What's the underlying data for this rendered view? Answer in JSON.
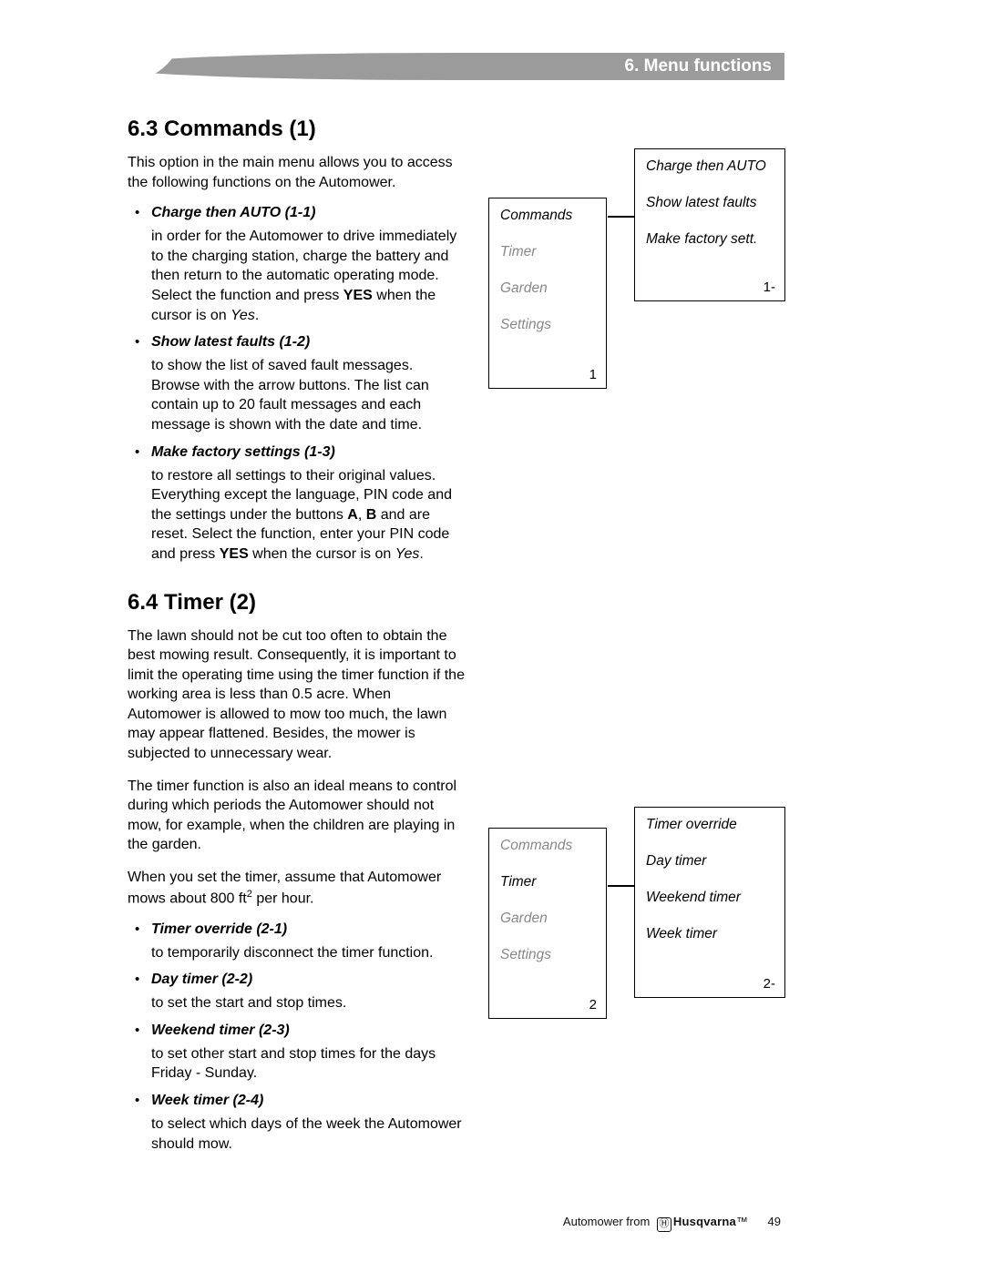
{
  "header": {
    "chapter": "6. Menu functions"
  },
  "section63": {
    "heading": "6.3 Commands (1)",
    "intro": "This option in the main menu allows you to access the following functions on the Automower.",
    "items": [
      {
        "title": "Charge then AUTO (1-1)",
        "desc_html": "in order for the Automower to drive immediately to the charging station, charge the battery and then return to the automatic operating mode. Select the function and press <b>YES</b> when the cursor is on <i>Yes</i>."
      },
      {
        "title": "Show latest faults (1-2)",
        "desc_html": "to show the list of saved fault messages. Browse with the arrow buttons. The list can contain up to 20 fault messages and each message is shown with the date and time."
      },
      {
        "title": "Make factory settings (1-3)",
        "desc_html": "to restore all settings to their original values. Everything except the language, PIN code and the settings under the buttons <b>A</b>, <b>B</b> and are reset. Select the function, enter your PIN code and press <b>YES</b> when the cursor is on <i>Yes</i>."
      }
    ]
  },
  "section64": {
    "heading": "6.4 Timer (2)",
    "para1": "The lawn should not be cut too often to obtain the best mowing result. Consequently, it is important to limit the operating time using the timer function if the working area is less than 0.5 acre. When Automower is allowed to mow too much, the lawn may appear flattened. Besides, the mower is subjected to unnecessary wear.",
    "para2": "The timer function is also an ideal means to control during which periods the Automower should not mow, for example, when the children are playing in the garden.",
    "para3_html": "When you set the timer, assume that Automower mows about 800 ft<span class='sup'>2</span> per hour.",
    "items": [
      {
        "title": "Timer override (2-1)",
        "desc_html": "to temporarily disconnect the timer function."
      },
      {
        "title": "Day timer (2-2)",
        "desc_html": "to set the start and stop times."
      },
      {
        "title": "Weekend timer (2-3)",
        "desc_html": "to set other start and stop times for the days Friday - Sunday."
      },
      {
        "title": "Week timer (2-4)",
        "desc_html": "to select which days of the week the Automower should mow."
      }
    ]
  },
  "diagram1": {
    "left": {
      "items": [
        "Commands",
        "Timer",
        "Garden",
        "Settings"
      ],
      "active_index": 0,
      "number": "1"
    },
    "right": {
      "items": [
        "Charge then AUTO",
        "Show latest faults",
        "Make factory sett."
      ],
      "number": "1-"
    }
  },
  "diagram2": {
    "left": {
      "items": [
        "Commands",
        "Timer",
        "Garden",
        "Settings"
      ],
      "active_index": 1,
      "number": "2"
    },
    "right": {
      "items": [
        "Timer override",
        "Day timer",
        "Weekend timer",
        "Week timer"
      ],
      "number": "2-"
    }
  },
  "footer": {
    "text_left": "Automower from ",
    "brand": "Husqvarna",
    "tm": "™",
    "page": "49"
  }
}
